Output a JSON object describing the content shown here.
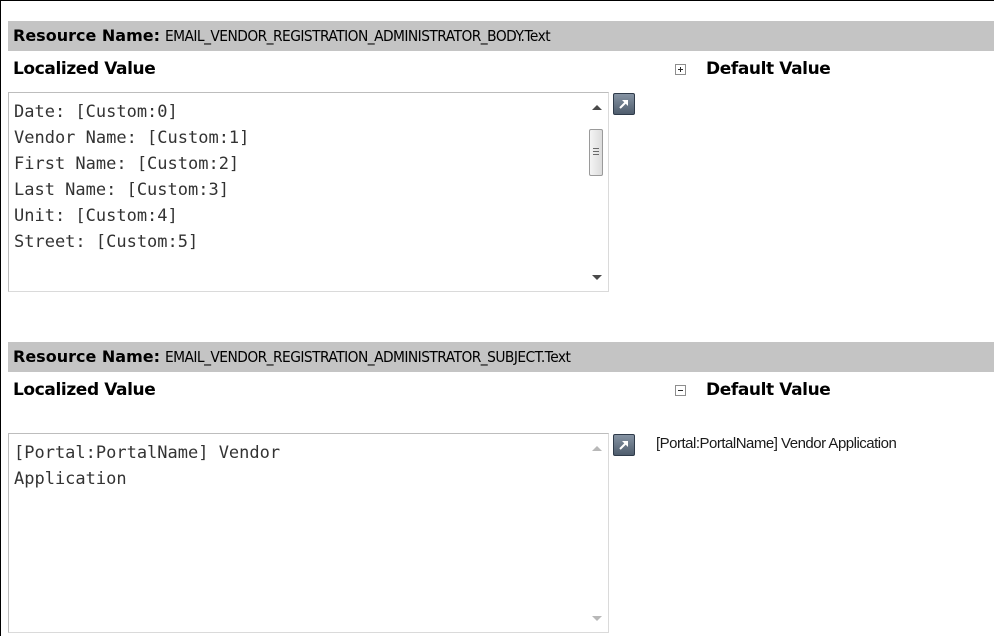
{
  "resources": [
    {
      "name_label": "Resource Name:",
      "name_value": "EMAIL_VENDOR_REGISTRATION_ADMINISTRATOR_BODY.Text",
      "localized_label": "Localized Value",
      "localized_value": "Date: [Custom:0]\nVendor Name: [Custom:1]\nFirst Name: [Custom:2]\nLast Name: [Custom:3]\nUnit: [Custom:4]\nStreet: [Custom:5]",
      "default_toggle_icon": "plus-toggle-icon",
      "default_label": "Default Value",
      "default_expanded": false,
      "default_value": ""
    },
    {
      "name_label": "Resource Name:",
      "name_value": "EMAIL_VENDOR_REGISTRATION_ADMINISTRATOR_SUBJECT.Text",
      "localized_label": "Localized Value",
      "localized_value": "[Portal:PortalName] Vendor\nApplication",
      "default_toggle_icon": "minus-toggle-icon",
      "default_label": "Default Value",
      "default_expanded": true,
      "default_value": "[Portal:PortalName] Vendor Application"
    }
  ],
  "icons": {
    "expand_editor": "expand-arrow-icon",
    "scroll_up": "scroll-up-icon",
    "scroll_down": "scroll-down-icon"
  },
  "colors": {
    "resource_bar": "#c4c4c4",
    "textbox_border": "#bdbdbd",
    "expand_button": "#5f6d7d"
  }
}
